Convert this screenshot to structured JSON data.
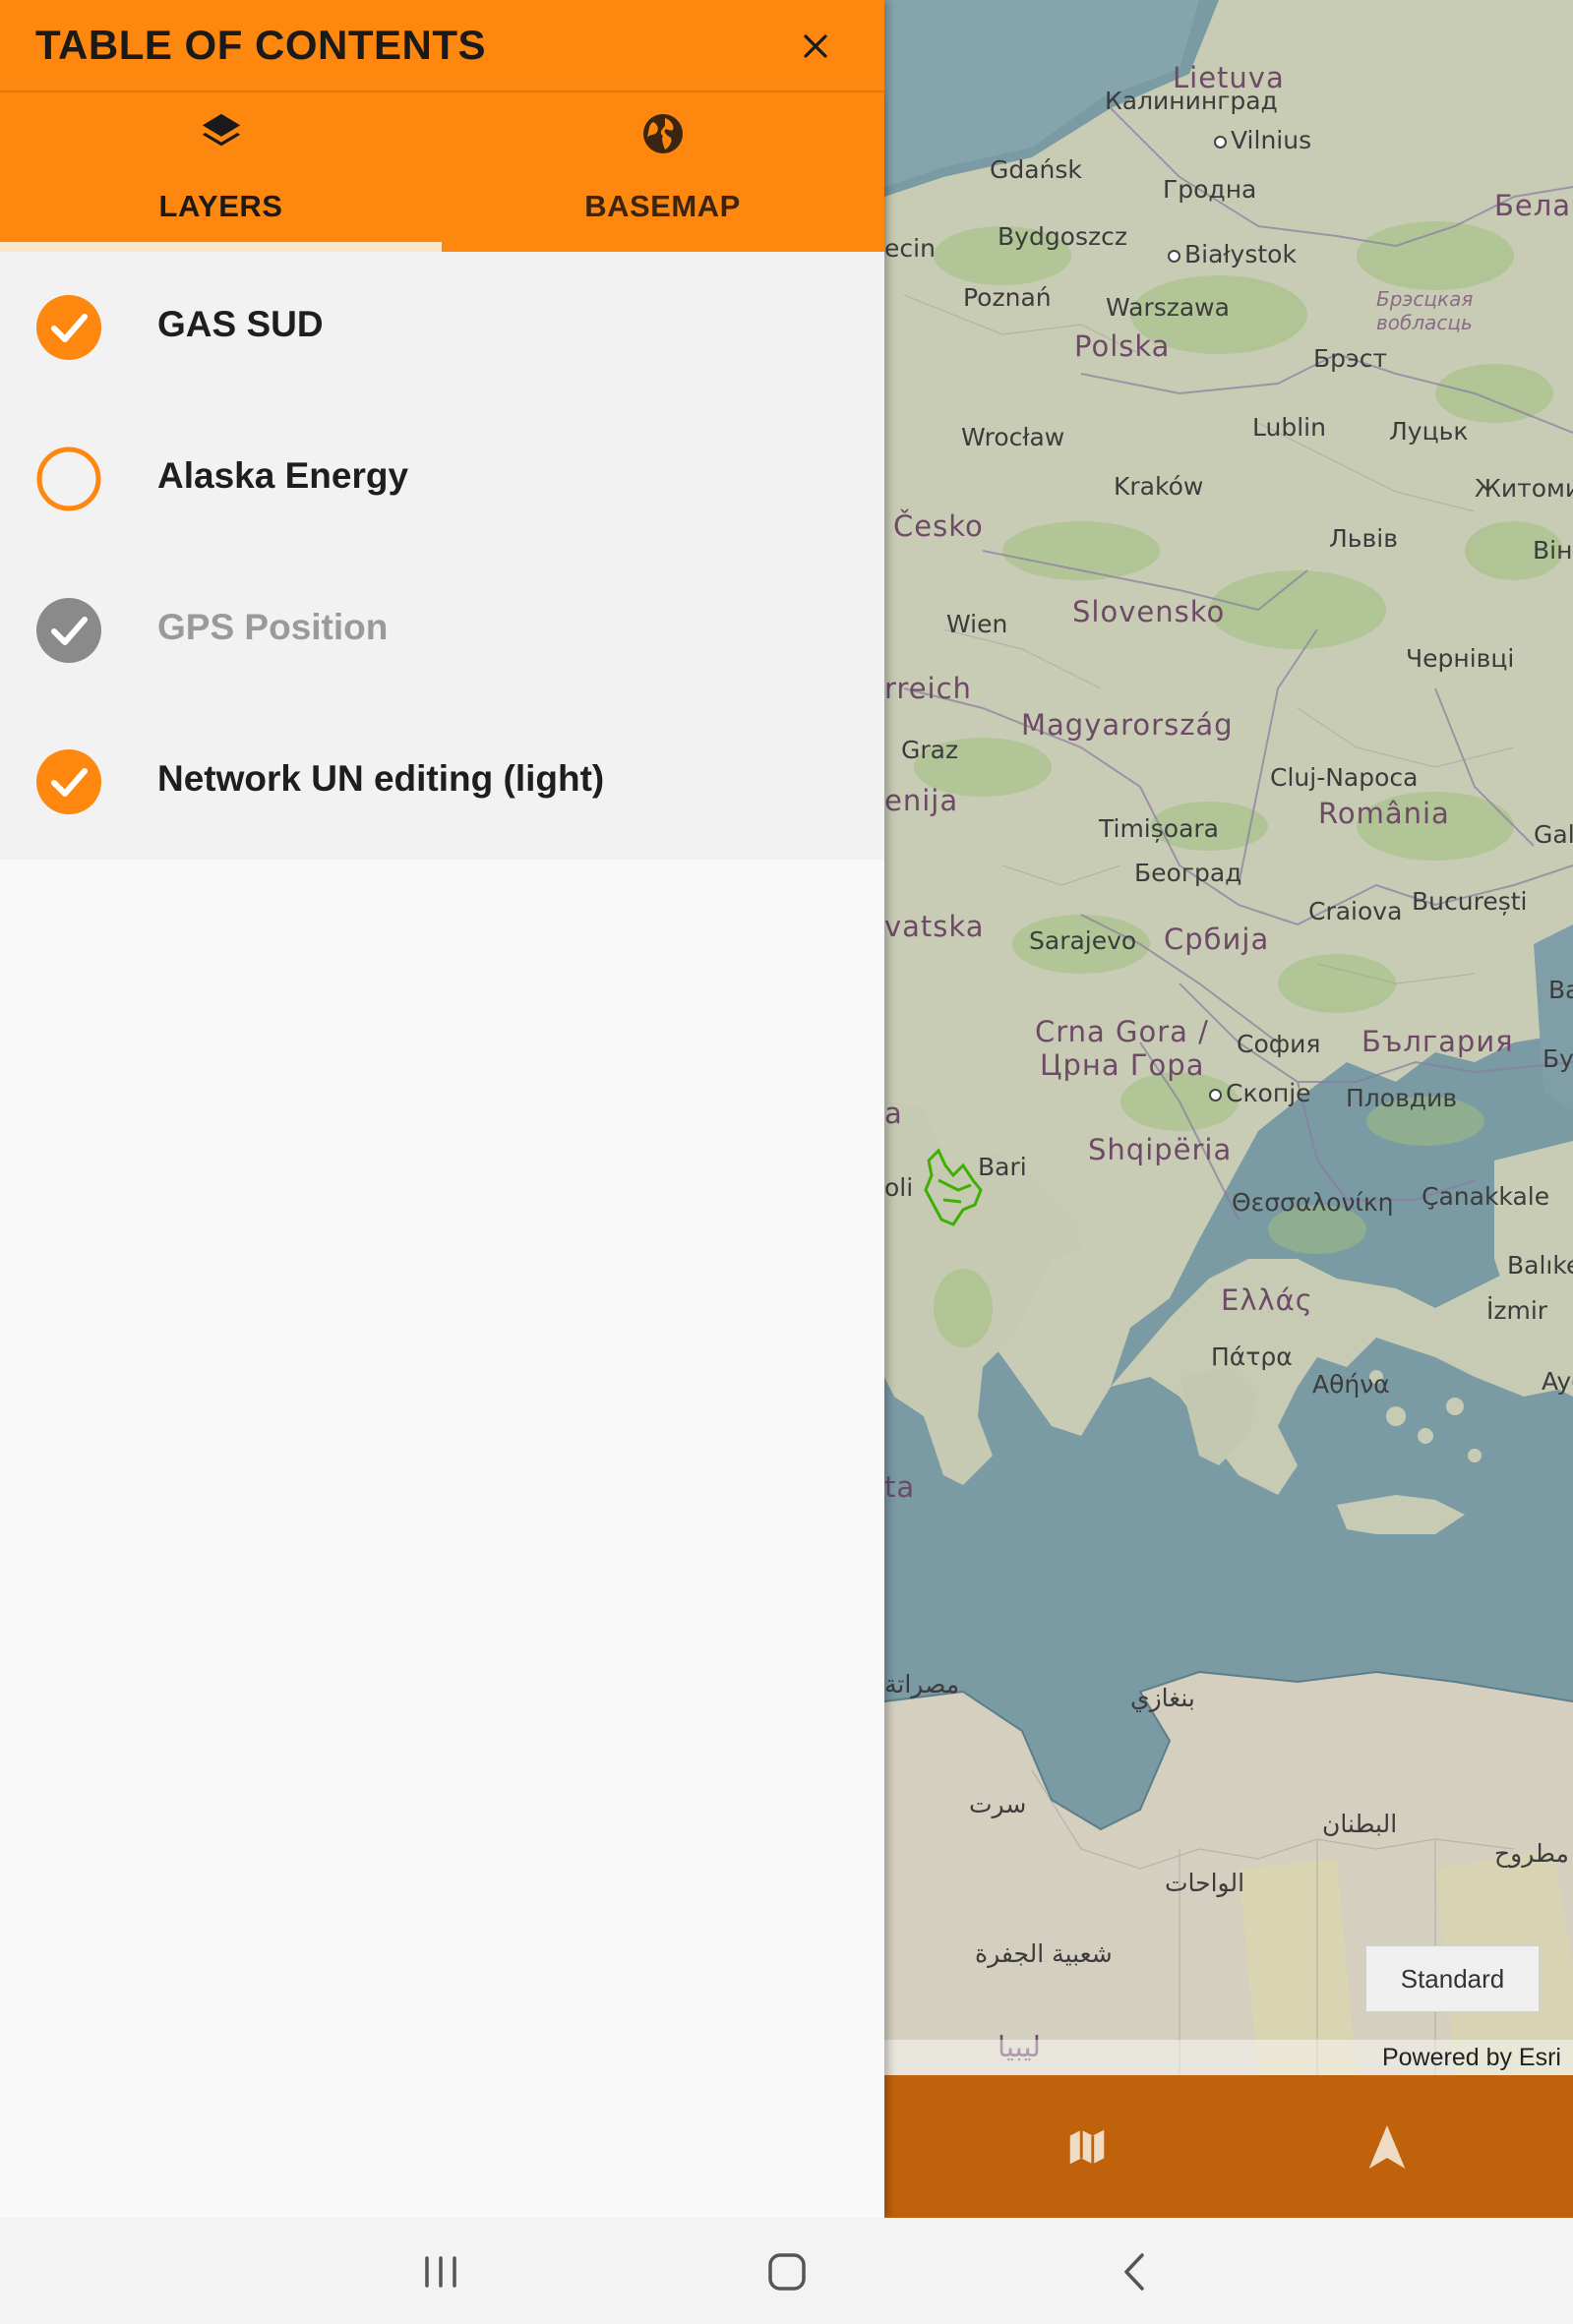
{
  "toc": {
    "title": "TABLE OF CONTENTS",
    "tabs": [
      {
        "label": "LAYERS",
        "icon": "layers-icon",
        "selected": true
      },
      {
        "label": "BASEMAP",
        "icon": "globe-icon",
        "selected": false
      }
    ],
    "layers": [
      {
        "name": "GAS SUD",
        "state": "checked"
      },
      {
        "name": "Alaska Energy",
        "state": "unchecked"
      },
      {
        "name": "GPS Position",
        "state": "disabled-checked"
      },
      {
        "name": "Network UN editing (light)",
        "state": "checked"
      }
    ]
  },
  "map": {
    "labels": {
      "lietuva": "Lietuva",
      "kaliningrad": "Калининград",
      "vilnius": "Vilnius",
      "gdansk": "Gdańsk",
      "grodno": "Гродна",
      "belarus": "Белар",
      "szczecin": "ecin",
      "bydgoszcz": "Bydgoszcz",
      "bialystok": "Białystok",
      "poznan": "Poznań",
      "warszawa": "Warszawa",
      "brest_region": "Брэсцкая вобласць",
      "polska": "Polska",
      "brest": "Брэст",
      "wroclaw": "Wrocław",
      "lublin": "Lublin",
      "lutsk": "Луцьк",
      "krakow": "Kraków",
      "zhytomyr": "Житоми",
      "cesko": "Česko",
      "lviv": "Львів",
      "vinnytsia": "Він",
      "wien": "Wien",
      "slovensko": "Slovensko",
      "osterreich": "rreich",
      "chernivtsi": "Чернівці",
      "graz": "Graz",
      "magyarorszag": "Magyarország",
      "slovenija": "enija",
      "cluj": "Cluj-Napoca",
      "romania": "România",
      "galati": "Gal",
      "timisoara": "Timișoara",
      "beograd": "Београд",
      "craiova": "Craiova",
      "bucuresti": "București",
      "hrvatska": "vatska",
      "sarajevo": "Sarajevo",
      "srbija": "Србија",
      "varna": "Вар",
      "crna_gora": "Crna Gora /",
      "crna_gora2": "Црна Гора",
      "sofia": "София",
      "bulgaria": "България",
      "burgas": "Бу",
      "skopje": "Скопје",
      "plovdiv": "Пловдив",
      "shqiperia": "Shqipëria",
      "bari": "Bari",
      "napoli": "oli",
      "italia": "a",
      "thessaloniki": "Θεσσαλονίκη",
      "canakkale": "Çanakkale",
      "balikesir": "Balıke",
      "ellas": "Ελλάς",
      "izmir": "İzmir",
      "patra": "Πάτρα",
      "athina": "Αθήνα",
      "aydin": "Aydı",
      "malta": "ta",
      "misrata": "مصراتة",
      "benghazi": "بنغازي",
      "sirt": "سرت",
      "butnan": "البطنان",
      "matruh": "مطروح",
      "wahat": "الواحات",
      "jufra": "شعبية الجفرة",
      "libya": "ليبيا"
    },
    "basemap_button": "Standard",
    "attribution": "Powered by Esri"
  },
  "toolbar": {
    "map_icon": "map-icon",
    "navigate_icon": "navigation-arrow-icon"
  },
  "nav": {
    "recents_icon": "recents-icon",
    "home_icon": "home-icon",
    "back_icon": "back-icon"
  },
  "colors": {
    "accent": "#fe870f",
    "toolbar": "#c0620c",
    "sea": "#7a9aa4",
    "land": "#c9cdb7",
    "feature_green": "#3fb000"
  }
}
